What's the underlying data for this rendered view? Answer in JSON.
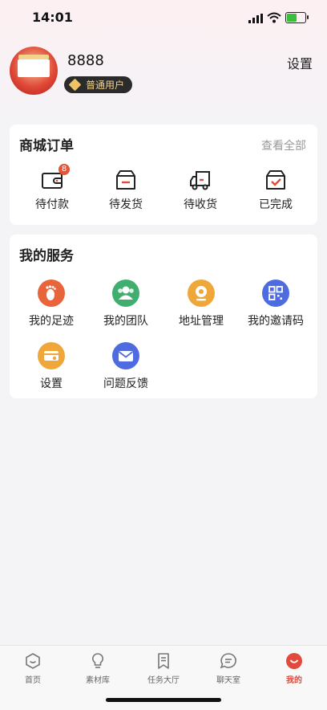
{
  "status_bar": {
    "time": "14:01"
  },
  "profile": {
    "username": "8888",
    "badge": "普通用户",
    "settings": "设置"
  },
  "orders": {
    "title": "商城订单",
    "see_all": "查看全部",
    "items": [
      {
        "label": "待付款",
        "icon": "wallet-icon",
        "count": "8"
      },
      {
        "label": "待发货",
        "icon": "box-icon"
      },
      {
        "label": "待收货",
        "icon": "truck-icon"
      },
      {
        "label": "已完成",
        "icon": "check-box-icon"
      }
    ]
  },
  "services": {
    "title": "我的服务",
    "items": [
      {
        "label": "我的足迹",
        "icon": "footprint-icon",
        "color": "#e8643a"
      },
      {
        "label": "我的团队",
        "icon": "team-icon",
        "color": "#3fae6f"
      },
      {
        "label": "地址管理",
        "icon": "location-icon",
        "color": "#f0a73a"
      },
      {
        "label": "我的邀请码",
        "icon": "qrcode-icon",
        "color": "#4f6be0"
      },
      {
        "label": "设置",
        "icon": "settings-box-icon",
        "color": "#f0a73a"
      },
      {
        "label": "问题反馈",
        "icon": "mail-icon",
        "color": "#4f6be0"
      }
    ]
  },
  "tabbar": {
    "tabs": [
      {
        "label": "首页",
        "icon": "home-icon"
      },
      {
        "label": "素材库",
        "icon": "bulb-icon"
      },
      {
        "label": "任务大厅",
        "icon": "bookmark-icon"
      },
      {
        "label": "聊天室",
        "icon": "chat-icon"
      },
      {
        "label": "我的",
        "icon": "profile-icon",
        "active": true
      }
    ]
  },
  "colors": {
    "accent": "#e24a3b",
    "badge_bg": "#2b2b2b",
    "badge_text": "#f4d48a"
  }
}
